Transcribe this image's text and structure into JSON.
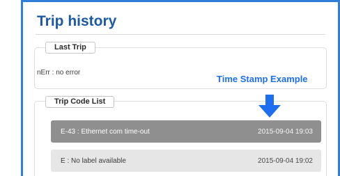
{
  "header": {
    "title": "Trip history"
  },
  "last_trip": {
    "label": "Last Trip",
    "text": "nErr : no error"
  },
  "annotation": {
    "text": "Time Stamp Example"
  },
  "trip_codes": {
    "label": "Trip Code List",
    "rows": [
      {
        "code": "E-43 : Ethernet com time-out",
        "timestamp": "2015-09-04 19:03",
        "selected": true
      },
      {
        "code": "E : No label available",
        "timestamp": "2015-09-04 19:02",
        "selected": false
      }
    ]
  },
  "colors": {
    "accent": "#2f7fd9",
    "title": "#1d5aa6",
    "annotation": "#1e6ff0",
    "selected_row": "#8f8f8f",
    "row": "#e6e6e6"
  },
  "icons": {
    "annotation_arrow": "arrow-down-icon"
  }
}
